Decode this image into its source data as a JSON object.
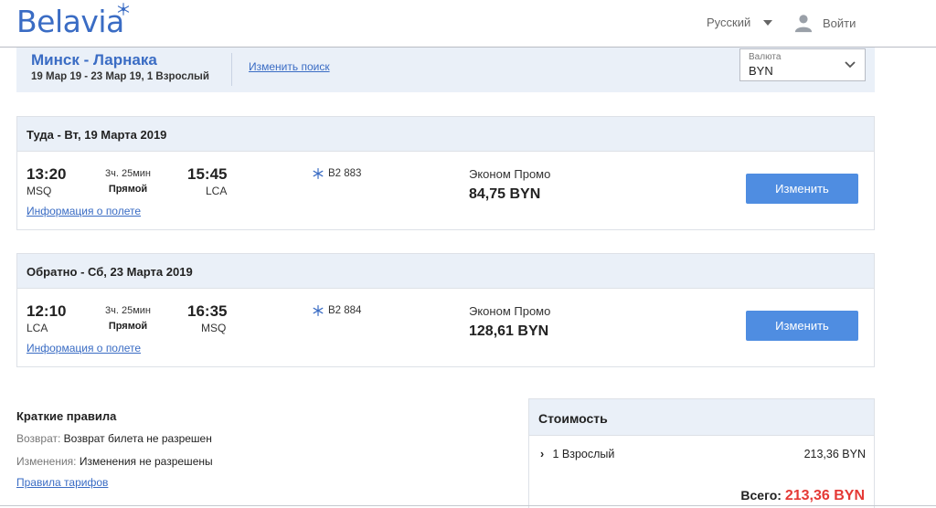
{
  "header": {
    "logo_text": "Belavia",
    "language": "Русский",
    "login": "Войти"
  },
  "search": {
    "route": "Минск - Ларнака",
    "dates": "19 Мар 19  -  23 Мар 19, 1 Взрослый",
    "change_search": "Изменить поиск",
    "currency_label": "Валюта",
    "currency_value": "BYN"
  },
  "outbound": {
    "title": "Туда - Вт, 19 Марта 2019",
    "dep_time": "13:20",
    "dep_code": "MSQ",
    "duration": "3ч. 25мин",
    "stops": "Прямой",
    "arr_time": "15:45",
    "arr_code": "LCA",
    "info_link": "Информация о полете",
    "flight_number": "B2 883",
    "fare": "Эконом Промо",
    "price": "84,75 BYN",
    "button": "Изменить"
  },
  "inbound": {
    "title": "Обратно - Сб, 23 Марта 2019",
    "dep_time": "12:10",
    "dep_code": "LCA",
    "duration": "3ч. 25мин",
    "stops": "Прямой",
    "arr_time": "16:35",
    "arr_code": "MSQ",
    "info_link": "Информация о полете",
    "flight_number": "B2 884",
    "fare": "Эконом Промо",
    "price": "128,61 BYN",
    "button": "Изменить"
  },
  "rules": {
    "title": "Краткие правила",
    "refund_key": "Возврат:",
    "refund_value": " Возврат билета не разрешен",
    "changes_key": "Изменения:",
    "changes_value": " Изменения не разрешены",
    "link": "Правила тарифов"
  },
  "cost": {
    "title": "Стоимость",
    "row_label": "1 Взрослый",
    "row_amount": "213,36 BYN",
    "total_label": "Всего: ",
    "total_value": "213,36 BYN"
  },
  "colors": {
    "brand": "#3a6cc4",
    "button": "#4f8de1",
    "total": "#e53935",
    "panel": "#eaf0f8"
  }
}
